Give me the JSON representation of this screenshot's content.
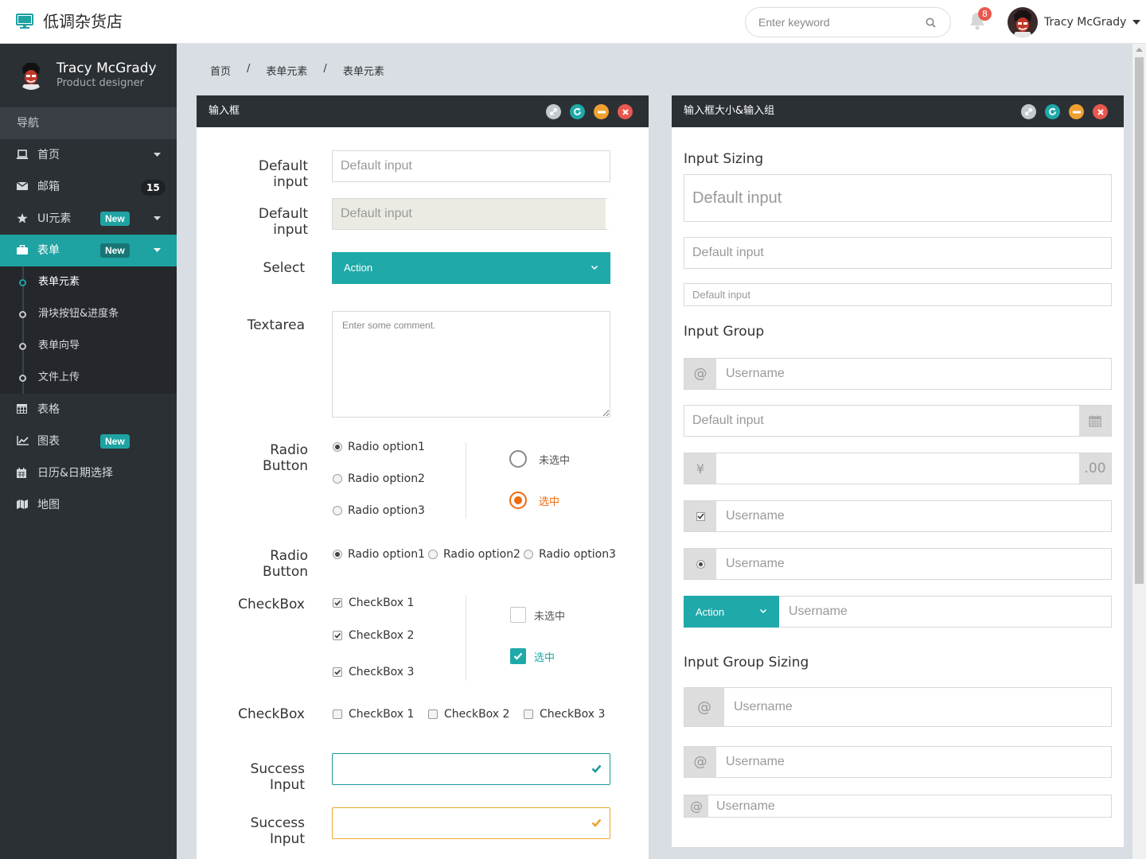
{
  "header": {
    "title": "低调杂货店",
    "search_placeholder": "Enter keyword",
    "notify_count": "8",
    "user_name": "Tracy McGrady"
  },
  "sidebar": {
    "profile_name": "Tracy McGrady",
    "profile_role": "Product designer",
    "nav_heading": "导航",
    "items": [
      {
        "label": "首页",
        "icon": "laptop-icon"
      },
      {
        "label": "邮箱",
        "icon": "envelope-icon",
        "count": "15"
      },
      {
        "label": "UI元素",
        "icon": "star-icon",
        "badge": "New"
      },
      {
        "label": "表单",
        "icon": "briefcase-icon",
        "badge": "New"
      },
      {
        "label": "表格",
        "icon": "table-icon"
      },
      {
        "label": "图表",
        "icon": "line-chart-icon",
        "badge": "New"
      },
      {
        "label": "日历&日期选择",
        "icon": "calendar-icon"
      },
      {
        "label": "地图",
        "icon": "map-icon"
      }
    ],
    "sub_items": [
      "表单元素",
      "滑块按钮&进度条",
      "表单向导",
      "文件上传"
    ]
  },
  "breadcrumb": [
    "首页",
    "表单元素",
    "表单元素"
  ],
  "breadcrumb_sep": "/",
  "left_panel": {
    "title": "输入框",
    "default_label_1": "Default input",
    "default_placeholder_1": "Default input",
    "default_label_2": "Default input",
    "default_placeholder_2": "Default input",
    "select_label": "Select",
    "select_value": "Action",
    "textarea_label": "Textarea",
    "textarea_placeholder": "Enter some comment.",
    "radio_label_1": "Radio Button",
    "radio_v": [
      "Radio option1",
      "Radio option2",
      "Radio option3"
    ],
    "radio_unchecked": "未选中",
    "radio_checked": "选中",
    "radio_label_2": "Radio Button",
    "radio_h": [
      "Radio option1",
      "Radio option2",
      "Radio option3"
    ],
    "checkbox_label_1": "CheckBox",
    "checkbox_v": [
      "CheckBox 1",
      "CheckBox 2",
      "CheckBox 3"
    ],
    "checkbox_unchecked": "未选中",
    "checkbox_checked": "选中",
    "checkbox_label_2": "CheckBox",
    "checkbox_h": [
      "CheckBox 1",
      "CheckBox 2",
      "CheckBox 3"
    ],
    "success_label_1": "Success Input",
    "success_label_2": "Success Input"
  },
  "right_panel": {
    "title": "输入框大小&输入组",
    "sizing_heading": "Input Sizing",
    "sizing_placeholders": [
      "Default input",
      "Default input",
      "Default input"
    ],
    "group_heading": "Input Group",
    "at_symbol": "@",
    "username_placeholder": "Username",
    "date_placeholder": "Default input",
    "yen_symbol": "¥",
    "cents_suffix": ".00",
    "action_label": "Action",
    "group_sizing_heading": "Input Group Sizing"
  },
  "colors": {
    "accent": "#1fa9a9",
    "sidebar_bg": "#2b3035",
    "orange": "#f06b0e",
    "warning": "#f0a030",
    "danger": "#e8584f"
  }
}
